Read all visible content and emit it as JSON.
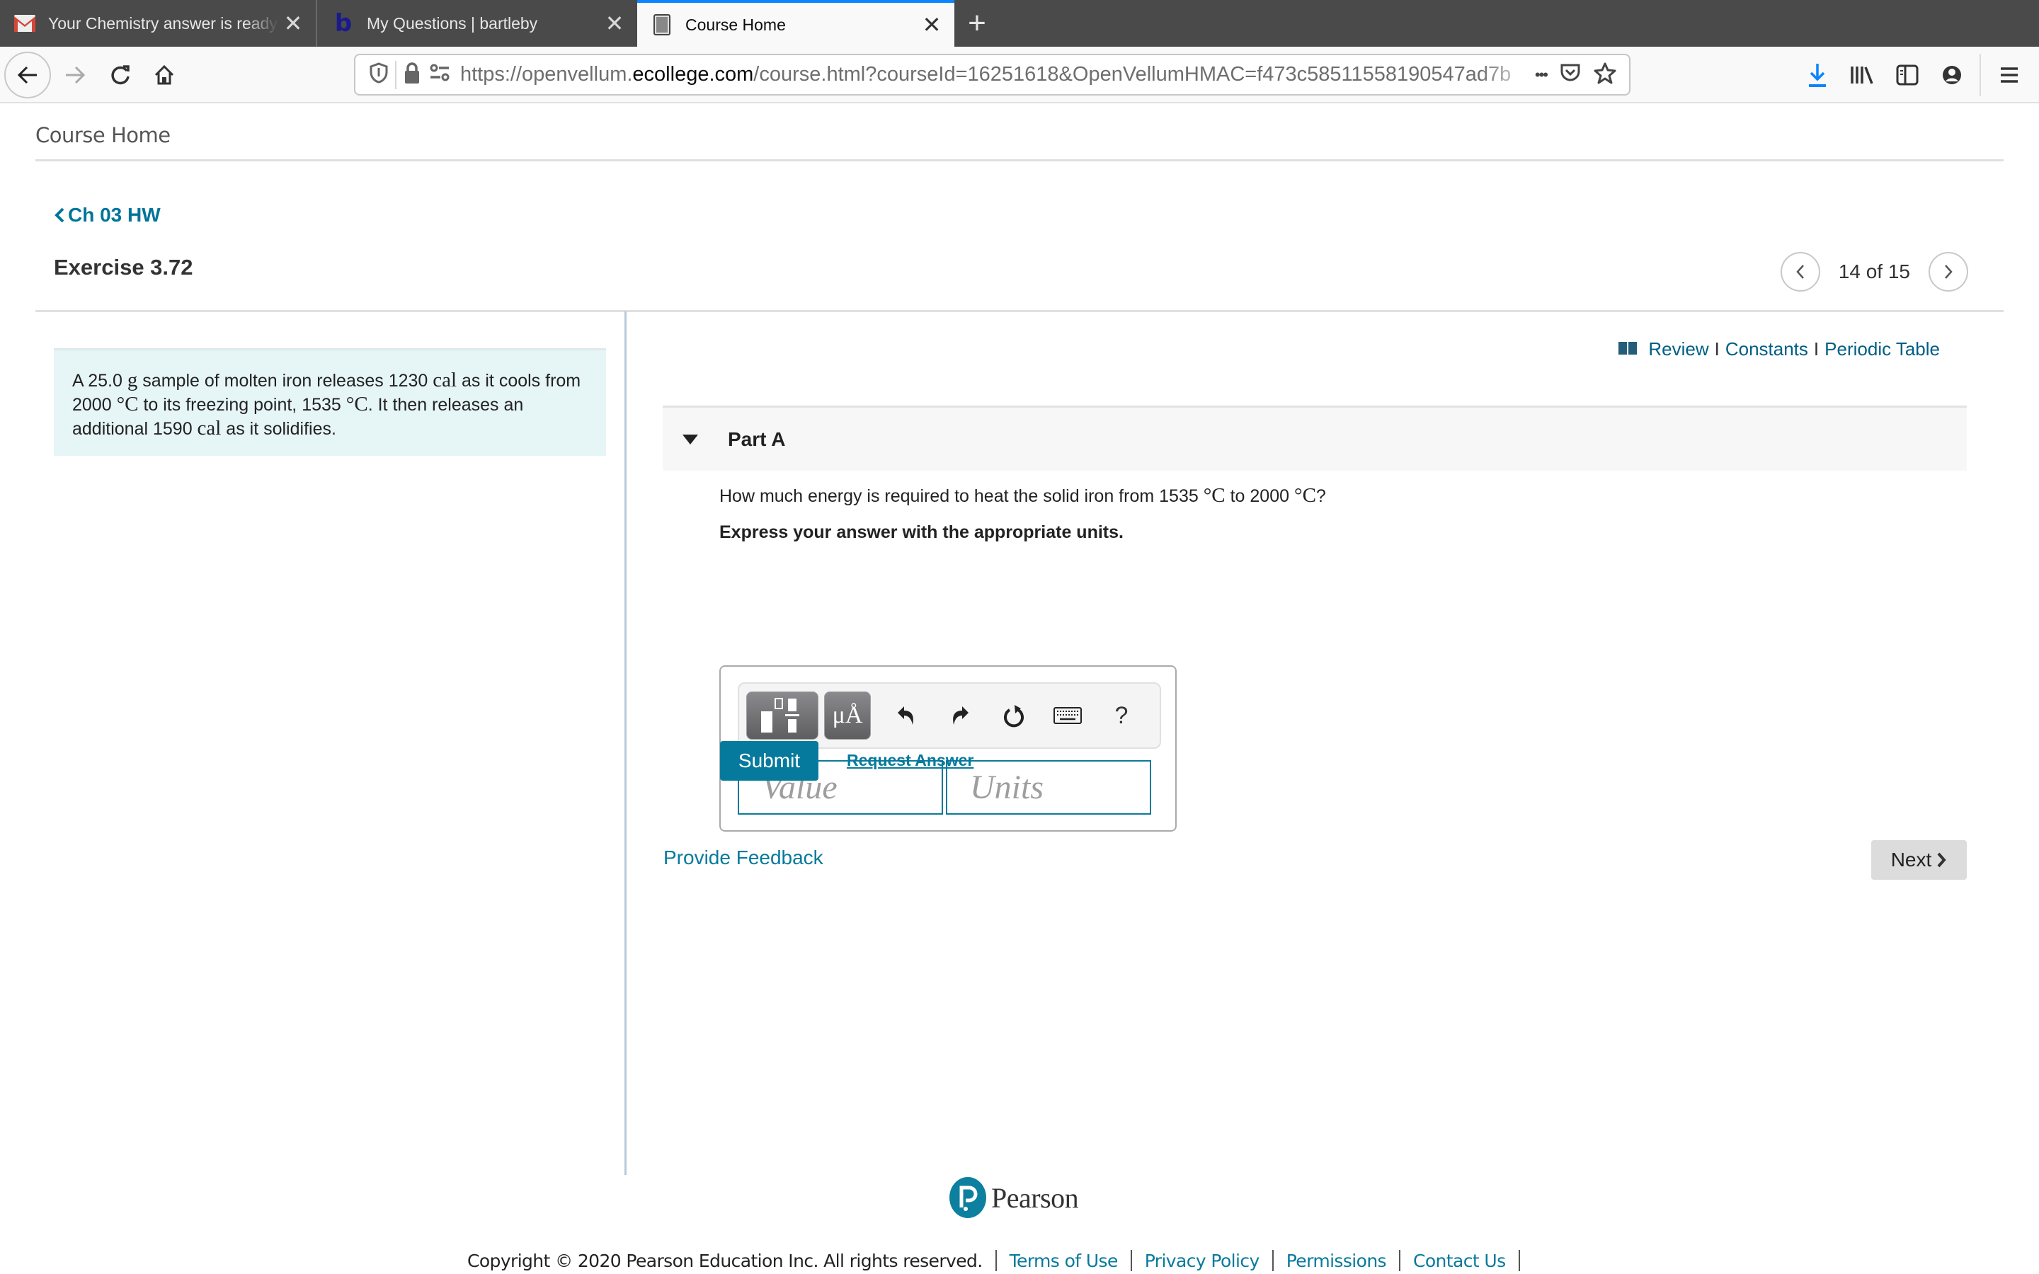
{
  "browser": {
    "tabs": [
      {
        "title": "Your Chemistry answer is ready",
        "favicon": "gmail-icon",
        "active": false
      },
      {
        "title": "My Questions | bartleby",
        "favicon": "bartleby-icon",
        "active": false
      },
      {
        "title": "Course Home",
        "favicon": "page-icon",
        "active": true
      }
    ],
    "url_prefix": "https://openvellum.",
    "url_domain": "ecollege.com",
    "url_path": "/course.html?courseId=16251618&OpenVellumHMAC=f473c58511558190547ad7b",
    "url_more": "•••",
    "accent_color": "#0a84ff"
  },
  "page": {
    "course_home": "Course Home",
    "back_link": "Ch 03 HW",
    "exercise_title": "Exercise 3.72",
    "pager": {
      "current": 14,
      "total": 15,
      "label": "14 of 15"
    },
    "resources": {
      "review": "Review",
      "constants": "Constants",
      "periodic_table": "Periodic Table",
      "separator": "I"
    },
    "problem": {
      "p1": "A 25.0 ",
      "m1": "g",
      "p2": " sample of molten iron releases 1230 ",
      "m2": "cal",
      "p3": " as it cools from 2000 ",
      "m3": "°C",
      "p4": " to its freezing point, 1535 ",
      "m4": "°C",
      "p5": ". It then releases an additional 1590 ",
      "m5": "cal",
      "p6": " as it solidifies."
    },
    "part": {
      "title": "Part A",
      "question_p1": "How much energy is required to heat the solid iron from 1535 ",
      "question_m1": "°C",
      "question_p2": " to 2000 ",
      "question_m2": "°C",
      "question_p3": "?",
      "instructions": "Express your answer with the appropriate units.",
      "toolbar": {
        "units_button": "μÅ",
        "help": "?"
      },
      "value_placeholder": "Value",
      "units_placeholder": "Units",
      "submit": "Submit",
      "request_answer": "Request Answer"
    },
    "provide_feedback": "Provide Feedback",
    "next": "Next",
    "brand_color": "#067a9c"
  },
  "footer": {
    "logo_text": "Pearson",
    "copyright": "Copyright © 2020 Pearson Education Inc. All rights reserved.",
    "links": [
      "Terms of Use",
      "Privacy Policy",
      "Permissions",
      "Contact Us"
    ]
  }
}
